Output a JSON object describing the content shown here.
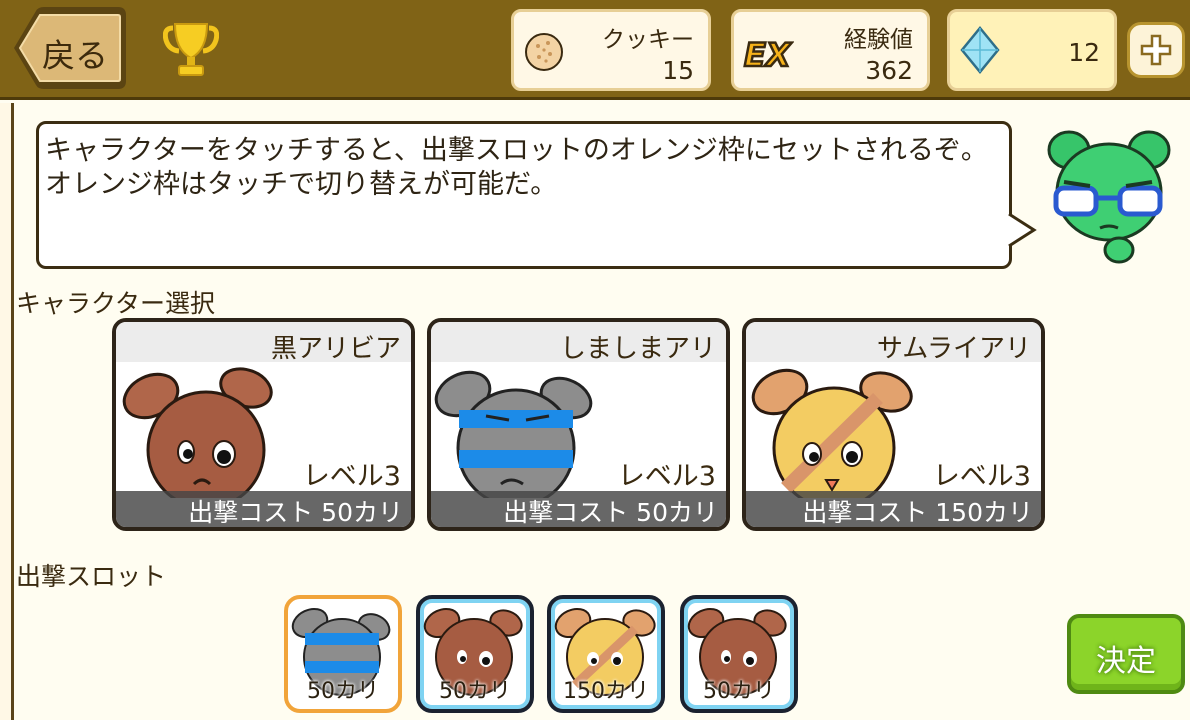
{
  "header": {
    "back_label": "戻る",
    "cookie": {
      "label": "クッキー",
      "value": "15"
    },
    "exp": {
      "label": "経験値",
      "value": "362",
      "badge": "EX"
    },
    "gems": {
      "value": "12"
    }
  },
  "tutorial": {
    "message": "キャラクターをタッチすると、出撃スロットのオレンジ枠にセットされるぞ。\nオレンジ枠はタッチで切り替えが可能だ。"
  },
  "character_select": {
    "title": "キャラクター選択",
    "cards": [
      {
        "name": "黒アリビア",
        "level": "レベル3",
        "cost": "出撃コスト 50カリ",
        "theme": "brown"
      },
      {
        "name": "しましまアリ",
        "level": "レベル3",
        "cost": "出撃コスト 50カリ",
        "theme": "striped"
      },
      {
        "name": "サムライアリ",
        "level": "レベル3",
        "cost": "出撃コスト 150カリ",
        "theme": "samurai"
      }
    ]
  },
  "slots": {
    "title": "出撃スロット",
    "items": [
      {
        "cost": "50カリ",
        "theme": "striped",
        "active": true
      },
      {
        "cost": "50カリ",
        "theme": "brown",
        "active": false
      },
      {
        "cost": "150カリ",
        "theme": "samurai",
        "active": false
      },
      {
        "cost": "50カリ",
        "theme": "brown",
        "active": false
      }
    ]
  },
  "decide_label": "決定",
  "colors": {
    "header_bg": "#806316",
    "content_bg": "#fffdf1",
    "active_slot": "#f1a43a",
    "slot_ring": "#7fd3f2",
    "decide_button": "#8cd42a"
  }
}
